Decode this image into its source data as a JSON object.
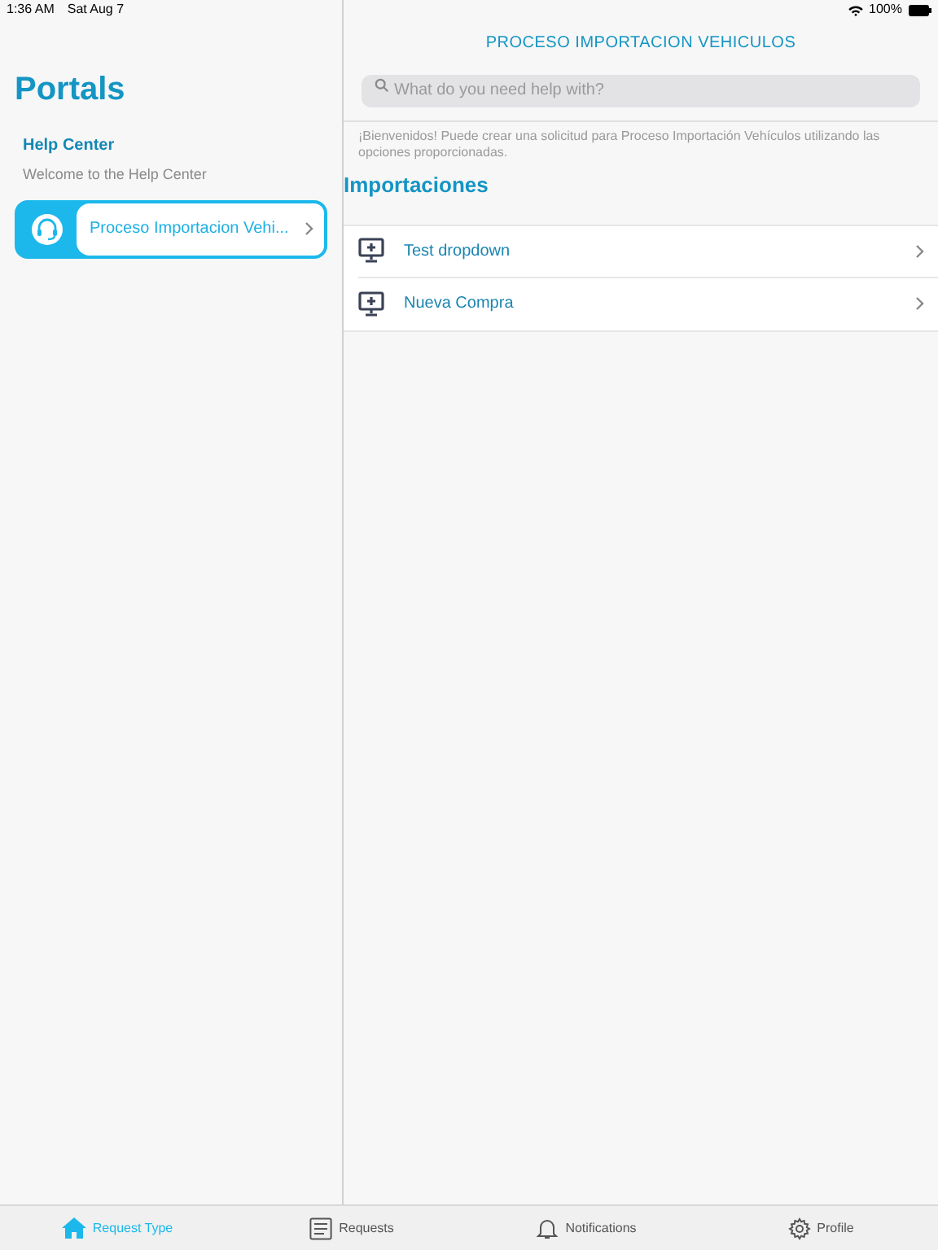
{
  "status_bar": {
    "time": "1:36 AM",
    "date": "Sat Aug 7",
    "battery": "100%"
  },
  "sidebar": {
    "title": "Portals",
    "section_title": "Help Center",
    "section_subtitle": "Welcome to the Help Center",
    "items": [
      {
        "label": "Proceso Importacion Vehi...",
        "selected": true
      }
    ]
  },
  "main": {
    "title": "PROCESO IMPORTACION VEHICULOS",
    "search": {
      "placeholder": "What do you need help with?"
    },
    "intro": "¡Bienvenidos! Puede crear una solicitud para Proceso Importación Vehículos utilizando las opciones proporcionadas.",
    "group_title": "Importaciones",
    "items": [
      {
        "label": "Test dropdown"
      },
      {
        "label": "Nueva Compra"
      }
    ]
  },
  "tab_bar": [
    {
      "label": "Request Type",
      "kind": "home",
      "selected": true
    },
    {
      "label": "Requests",
      "kind": "list",
      "selected": false
    },
    {
      "label": "Notifications",
      "kind": "bell",
      "selected": false
    },
    {
      "label": "Profile",
      "kind": "gear",
      "selected": false
    }
  ]
}
